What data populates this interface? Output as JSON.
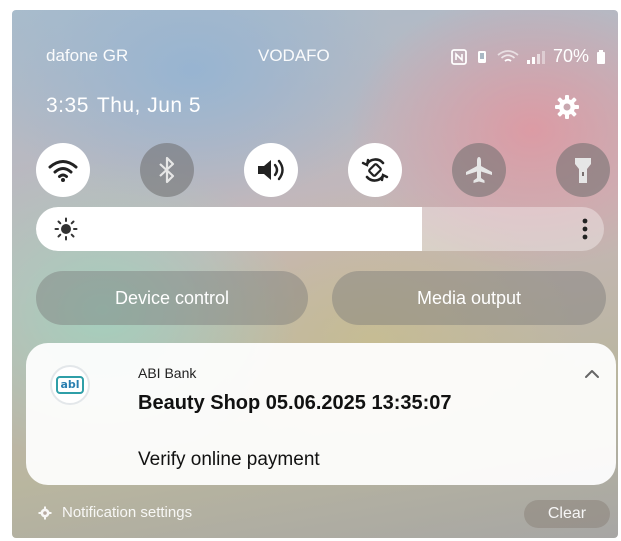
{
  "status_bar": {
    "carrier_primary": "dafone GR",
    "carrier_secondary": "VODAFO",
    "battery_percent": "70%",
    "icons": [
      "nfc-icon",
      "vibrate-icon",
      "wifi-signal-icon",
      "cell-signal-icon",
      "battery-icon"
    ]
  },
  "header": {
    "time": "3:35",
    "date": "Thu, Jun 5",
    "settings_icon": "gear-icon"
  },
  "quick_settings": [
    {
      "icon": "wifi-icon",
      "state": "on"
    },
    {
      "icon": "bluetooth-icon",
      "state": "off"
    },
    {
      "icon": "sound-icon",
      "state": "on"
    },
    {
      "icon": "auto-rotate-icon",
      "state": "on"
    },
    {
      "icon": "airplane-mode-icon",
      "state": "off"
    },
    {
      "icon": "flashlight-icon",
      "state": "off"
    }
  ],
  "brightness": {
    "level_fraction": 0.68,
    "icon": "sun-icon",
    "more_icon": "more-vertical-icon"
  },
  "controls": {
    "device_control": "Device control",
    "media_output": "Media output"
  },
  "notification": {
    "app_name": "ABI Bank",
    "app_logo_text": "abl",
    "title": "Beauty Shop  05.06.2025 13:35:07",
    "body": "Verify online payment",
    "collapse_icon": "chevron-up-icon"
  },
  "footer": {
    "notification_settings": "Notification settings",
    "clear": "Clear"
  },
  "colors": {
    "tile_on": "#ffffff",
    "tile_off": "#6e6e6e",
    "icon_dark": "#222222",
    "logo_teal": "#2f9fa8"
  }
}
